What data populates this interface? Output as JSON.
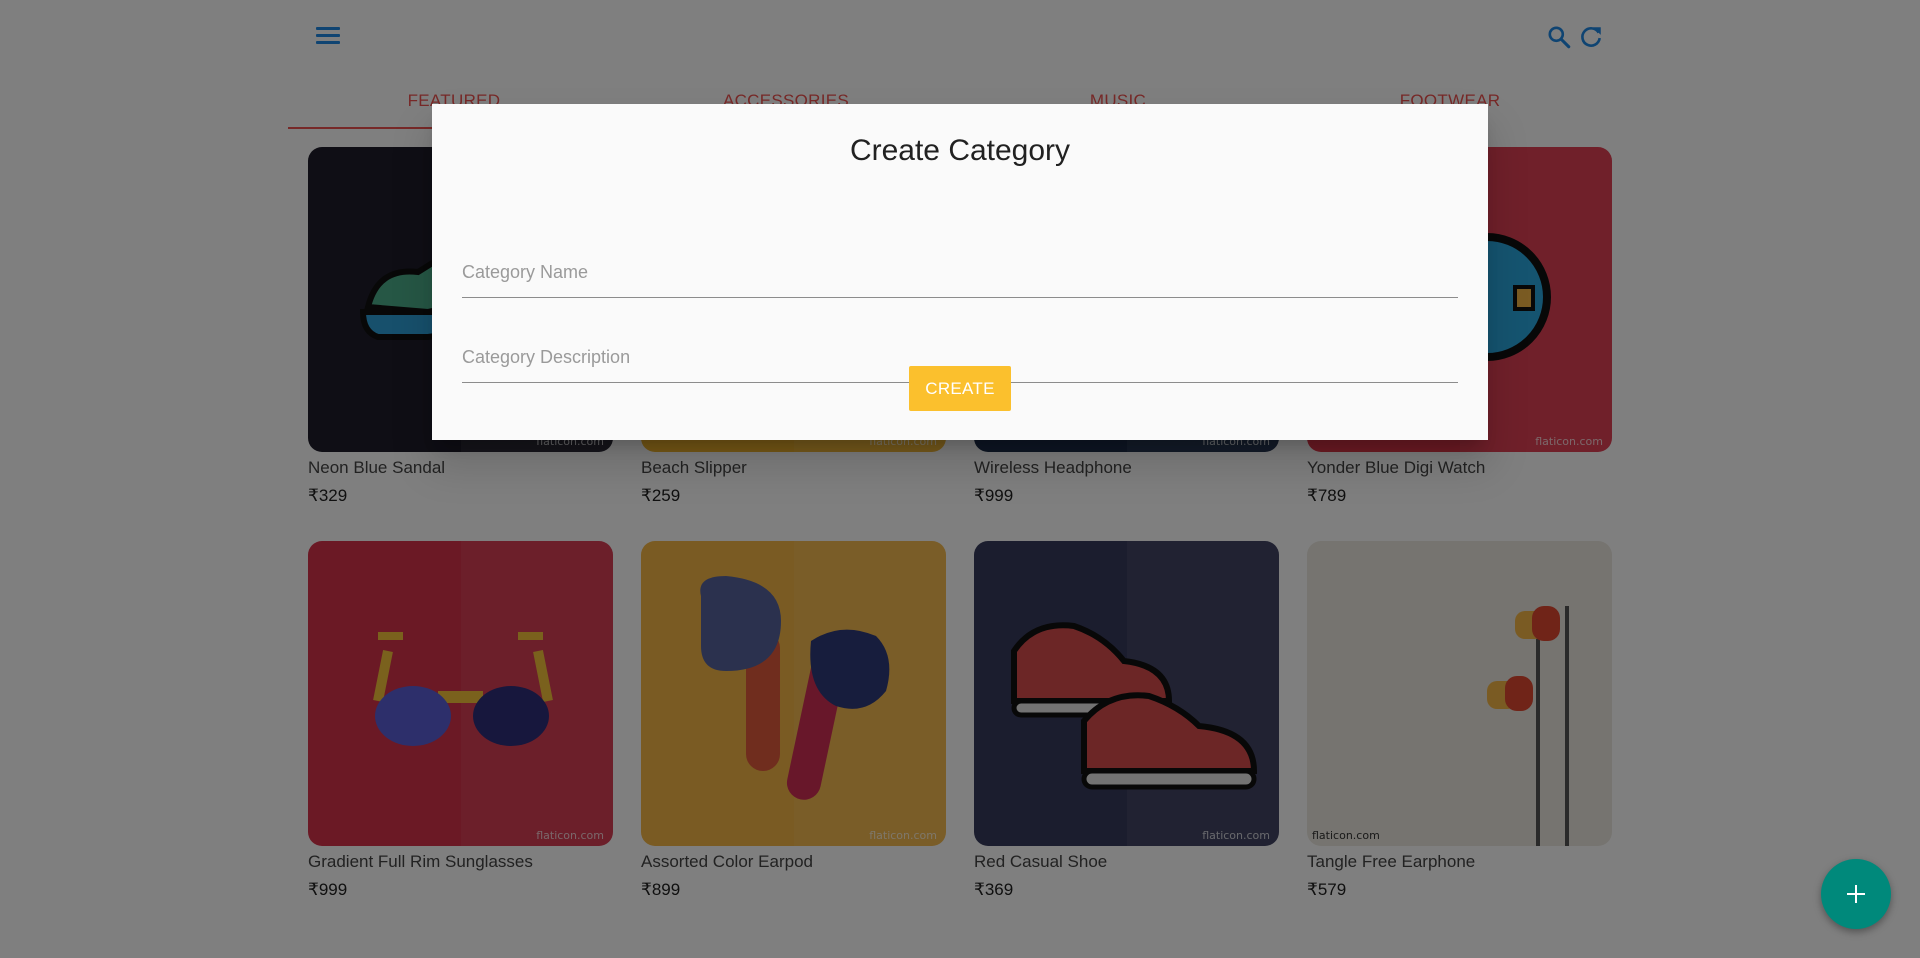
{
  "header": {
    "menu_icon": "hamburger-menu-icon",
    "search_icon": "search-icon",
    "refresh_icon": "refresh-icon",
    "icon_color": "#1e88e5"
  },
  "tabs": [
    {
      "label": "FEATURED",
      "active": true
    },
    {
      "label": "ACCESSORIES",
      "active": false
    },
    {
      "label": "MUSIC",
      "active": false
    },
    {
      "label": "FOOTWEAR",
      "active": false
    }
  ],
  "products": [
    {
      "name": "Neon Blue Sandal",
      "price": "₹329",
      "bg": "#1f1d2b",
      "watermark": "flaticon.com"
    },
    {
      "name": "Beach Slipper",
      "price": "₹259",
      "bg": "#f2b52c",
      "watermark": "flaticon.com"
    },
    {
      "name": "Wireless Headphone",
      "price": "₹999",
      "bg": "#1c2d4a",
      "watermark": "flaticon.com"
    },
    {
      "name": "Yonder Blue Digi Watch",
      "price": "₹789",
      "bg": "#e0364a",
      "watermark": "flaticon.com"
    },
    {
      "name": "Gradient Full Rim Sunglasses",
      "price": "₹999",
      "bg": "#d6324a",
      "watermark": "flaticon.com"
    },
    {
      "name": "Assorted Color Earpod",
      "price": "₹899",
      "bg": "#f4b646",
      "watermark": "flaticon.com"
    },
    {
      "name": "Red Casual Shoe",
      "price": "₹369",
      "bg": "#373a5c",
      "watermark": "flaticon.com"
    },
    {
      "name": "Tangle Free Earphone",
      "price": "₹579",
      "bg": "#ece9e0",
      "watermark": "flaticon.com"
    }
  ],
  "dialog": {
    "title": "Create Category",
    "name_placeholder": "Category Name",
    "name_value": "",
    "description_placeholder": "Category Description",
    "description_value": "",
    "create_label": "CREATE",
    "create_color": "#fbc02d"
  },
  "fab": {
    "icon": "plus-icon",
    "color": "#00897b"
  }
}
